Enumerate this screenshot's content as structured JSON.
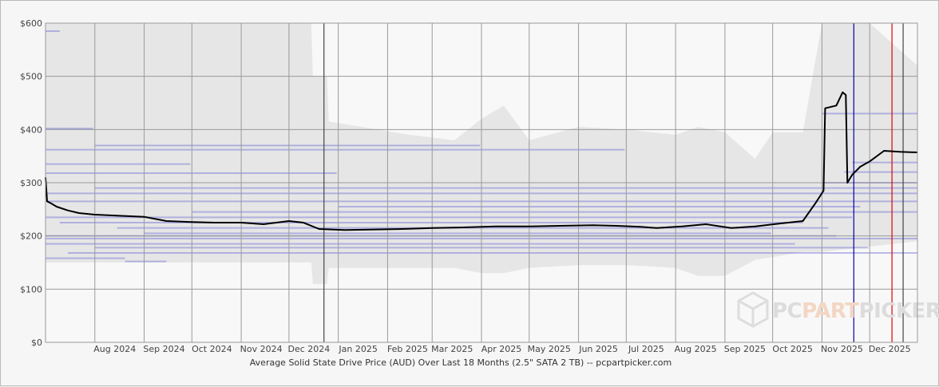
{
  "chart_data": {
    "type": "line",
    "title": "Average Solid State Drive Price (AUD) Over Last 18 Months (2.5\" SATA 2 TB) -- pcpartpicker.com",
    "xlabel": "",
    "ylabel": "",
    "x_start": "2024-07-01",
    "x_end": "2025-12-31",
    "ylim": [
      0,
      600
    ],
    "y_ticks": [
      {
        "value": 0,
        "label": "$0"
      },
      {
        "value": 100,
        "label": "$100"
      },
      {
        "value": 200,
        "label": "$200"
      },
      {
        "value": 300,
        "label": "$300"
      },
      {
        "value": 400,
        "label": "$400"
      },
      {
        "value": 500,
        "label": "$500"
      },
      {
        "value": 600,
        "label": "$600"
      }
    ],
    "x_ticks": [
      {
        "date": "2024-08-01",
        "label": "Aug 2024"
      },
      {
        "date": "2024-09-01",
        "label": "Sep 2024"
      },
      {
        "date": "2024-10-01",
        "label": "Oct 2024"
      },
      {
        "date": "2024-11-01",
        "label": "Nov 2024"
      },
      {
        "date": "2024-12-01",
        "label": "Dec 2024"
      },
      {
        "date": "2025-01-01",
        "label": "Jan 2025"
      },
      {
        "date": "2025-02-01",
        "label": "Feb 2025"
      },
      {
        "date": "2025-03-01",
        "label": "Mar 2025"
      },
      {
        "date": "2025-04-01",
        "label": "Apr 2025"
      },
      {
        "date": "2025-05-01",
        "label": "May 2025"
      },
      {
        "date": "2025-06-01",
        "label": "Jun 2025"
      },
      {
        "date": "2025-07-01",
        "label": "Jul 2025"
      },
      {
        "date": "2025-08-01",
        "label": "Aug 2025"
      },
      {
        "date": "2025-09-01",
        "label": "Sep 2025"
      },
      {
        "date": "2025-10-01",
        "label": "Oct 2025"
      },
      {
        "date": "2025-11-01",
        "label": "Nov 2025"
      },
      {
        "date": "2025-12-01",
        "label": "Dec 2025"
      }
    ],
    "grid": true,
    "series": [
      {
        "color": "#000000",
        "x": [
          "2024-07-01",
          "2024-07-02",
          "2024-07-04",
          "2024-07-08",
          "2024-07-15",
          "2024-07-22",
          "2024-08-01",
          "2024-08-15",
          "2024-09-01",
          "2024-09-15",
          "2024-10-01",
          "2024-10-15",
          "2024-11-01",
          "2024-11-15",
          "2024-12-01",
          "2024-12-10",
          "2024-12-20",
          "2025-01-05",
          "2025-01-20",
          "2025-02-10",
          "2025-03-01",
          "2025-03-20",
          "2025-04-10",
          "2025-05-01",
          "2025-05-20",
          "2025-06-10",
          "2025-06-25",
          "2025-07-10",
          "2025-07-20",
          "2025-08-05",
          "2025-08-20",
          "2025-09-05",
          "2025-09-20",
          "2025-10-05",
          "2025-10-20",
          "2025-10-28",
          "2025-11-02",
          "2025-11-03",
          "2025-11-10",
          "2025-11-14",
          "2025-11-16",
          "2025-11-17",
          "2025-11-20",
          "2025-11-25",
          "2025-12-01",
          "2025-12-10",
          "2025-12-20",
          "2025-12-31"
        ],
        "y": [
          310,
          265,
          262,
          255,
          248,
          243,
          240,
          238,
          236,
          228,
          226,
          225,
          225,
          222,
          228,
          225,
          213,
          211,
          212,
          213,
          215,
          216,
          218,
          218,
          219,
          220,
          219,
          217,
          215,
          218,
          222,
          215,
          218,
          223,
          228,
          262,
          285,
          440,
          445,
          470,
          465,
          300,
          315,
          330,
          340,
          360,
          358,
          357
        ]
      }
    ],
    "reference_lines": [
      {
        "date": "2024-12-23",
        "color": "#444444"
      },
      {
        "date": "2025-11-21",
        "color": "#0000aa"
      },
      {
        "date": "2025-12-15",
        "color": "#dd0000"
      },
      {
        "date": "2025-12-22",
        "color": "#444444"
      }
    ],
    "listing_bands": [
      {
        "price": 158,
        "from": "2024-07-01",
        "to": "2024-08-20"
      },
      {
        "price": 152,
        "from": "2024-08-20",
        "to": "2024-09-15"
      },
      {
        "price": 168,
        "from": "2024-07-15",
        "to": "2025-12-31"
      },
      {
        "price": 178,
        "from": "2024-08-01",
        "to": "2025-11-30"
      },
      {
        "price": 185,
        "from": "2024-07-01",
        "to": "2025-10-15"
      },
      {
        "price": 195,
        "from": "2024-07-01",
        "to": "2025-12-31"
      },
      {
        "price": 200,
        "from": "2024-07-01",
        "to": "2025-11-10"
      },
      {
        "price": 205,
        "from": "2024-09-01",
        "to": "2025-09-30"
      },
      {
        "price": 215,
        "from": "2024-08-15",
        "to": "2025-11-05"
      },
      {
        "price": 225,
        "from": "2024-07-10",
        "to": "2025-10-20"
      },
      {
        "price": 235,
        "from": "2024-07-01",
        "to": "2025-11-20"
      },
      {
        "price": 245,
        "from": "2024-10-01",
        "to": "2025-12-31"
      },
      {
        "price": 255,
        "from": "2025-01-01",
        "to": "2025-11-25"
      },
      {
        "price": 265,
        "from": "2024-07-01",
        "to": "2025-12-31"
      },
      {
        "price": 280,
        "from": "2024-07-01",
        "to": "2025-12-31"
      },
      {
        "price": 290,
        "from": "2024-08-01",
        "to": "2025-12-31"
      },
      {
        "price": 300,
        "from": "2025-11-01",
        "to": "2025-12-31"
      },
      {
        "price": 318,
        "from": "2024-07-01",
        "to": "2024-12-31"
      },
      {
        "price": 320,
        "from": "2025-11-15",
        "to": "2025-12-31"
      },
      {
        "price": 335,
        "from": "2024-07-01",
        "to": "2024-09-30"
      },
      {
        "price": 338,
        "from": "2025-11-20",
        "to": "2025-12-31"
      },
      {
        "price": 362,
        "from": "2024-07-01",
        "to": "2025-06-30"
      },
      {
        "price": 370,
        "from": "2024-08-01",
        "to": "2025-03-31"
      },
      {
        "price": 402,
        "from": "2024-07-01",
        "to": "2024-07-31"
      },
      {
        "price": 430,
        "from": "2025-11-01",
        "to": "2025-12-31"
      },
      {
        "price": 585,
        "from": "2024-07-01",
        "to": "2024-07-10"
      }
    ],
    "range_area": [
      {
        "x": "2024-07-01",
        "low": 150,
        "high": 600
      },
      {
        "x": "2024-12-15",
        "low": 150,
        "high": 600
      },
      {
        "x": "2024-12-16",
        "low": 110,
        "high": 500
      },
      {
        "x": "2024-12-25",
        "low": 110,
        "high": 500
      },
      {
        "x": "2024-12-26",
        "low": 140,
        "high": 415
      },
      {
        "x": "2025-02-15",
        "low": 140,
        "high": 390
      },
      {
        "x": "2025-03-15",
        "low": 140,
        "high": 380
      },
      {
        "x": "2025-04-01",
        "low": 130,
        "high": 420
      },
      {
        "x": "2025-04-15",
        "low": 130,
        "high": 445
      },
      {
        "x": "2025-05-01",
        "low": 140,
        "high": 380
      },
      {
        "x": "2025-06-01",
        "low": 145,
        "high": 405
      },
      {
        "x": "2025-07-01",
        "low": 145,
        "high": 400
      },
      {
        "x": "2025-08-01",
        "low": 140,
        "high": 390
      },
      {
        "x": "2025-08-15",
        "low": 125,
        "high": 405
      },
      {
        "x": "2025-09-01",
        "low": 125,
        "high": 395
      },
      {
        "x": "2025-09-20",
        "low": 155,
        "high": 345
      },
      {
        "x": "2025-10-01",
        "low": 160,
        "high": 395
      },
      {
        "x": "2025-10-20",
        "low": 170,
        "high": 395
      },
      {
        "x": "2025-11-01",
        "low": 170,
        "high": 600
      },
      {
        "x": "2025-12-01",
        "low": 180,
        "high": 600
      },
      {
        "x": "2025-12-31",
        "low": 190,
        "high": 520
      }
    ]
  },
  "watermark": {
    "part1": "PC",
    "part2": "PART",
    "part3": "PICKER",
    "color1": "#dcdcdc",
    "color2": "#f3d6c3",
    "color3": "#dcdcdc"
  }
}
